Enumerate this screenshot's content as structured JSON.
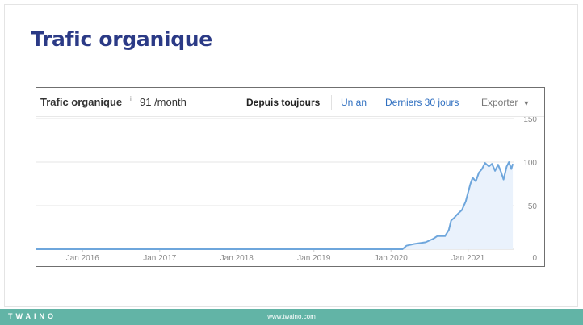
{
  "slide": {
    "title": "Trafic organique"
  },
  "widget": {
    "title": "Trafic organique",
    "info_marker": "i",
    "value": "91 /month",
    "ranges": {
      "all_time": "Depuis toujours",
      "one_year": "Un an",
      "last_30_days": "Derniers 30 jours"
    },
    "export_label": "Exporter",
    "export_caret": "▼"
  },
  "chart_data": {
    "type": "area",
    "x_ticks": [
      "Jan 2016",
      "Jan 2017",
      "Jan 2018",
      "Jan 2019",
      "Jan 2020",
      "Jan 2021"
    ],
    "y_ticks": [
      "150",
      "100",
      "50",
      "0"
    ],
    "ylim": [
      0,
      150
    ],
    "xlim": [
      2015.4,
      2021.6
    ],
    "grid": true,
    "line_color": "#6ea6dc",
    "fill_color": "#eaf2fc",
    "points": [
      [
        2015.4,
        0
      ],
      [
        2020.15,
        0
      ],
      [
        2020.2,
        4
      ],
      [
        2020.3,
        6
      ],
      [
        2020.45,
        8
      ],
      [
        2020.55,
        12
      ],
      [
        2020.6,
        15
      ],
      [
        2020.7,
        15
      ],
      [
        2020.75,
        22
      ],
      [
        2020.78,
        33
      ],
      [
        2020.82,
        36
      ],
      [
        2020.86,
        40
      ],
      [
        2020.92,
        45
      ],
      [
        2020.97,
        55
      ],
      [
        2021.0,
        65
      ],
      [
        2021.03,
        75
      ],
      [
        2021.06,
        82
      ],
      [
        2021.1,
        78
      ],
      [
        2021.14,
        88
      ],
      [
        2021.18,
        92
      ],
      [
        2021.22,
        99
      ],
      [
        2021.27,
        95
      ],
      [
        2021.31,
        98
      ],
      [
        2021.35,
        90
      ],
      [
        2021.39,
        97
      ],
      [
        2021.43,
        88
      ],
      [
        2021.46,
        80
      ],
      [
        2021.5,
        95
      ],
      [
        2021.53,
        100
      ],
      [
        2021.56,
        92
      ],
      [
        2021.58,
        98
      ]
    ]
  },
  "footer": {
    "logo": "TWAINO",
    "url": "www.twaino.com"
  }
}
